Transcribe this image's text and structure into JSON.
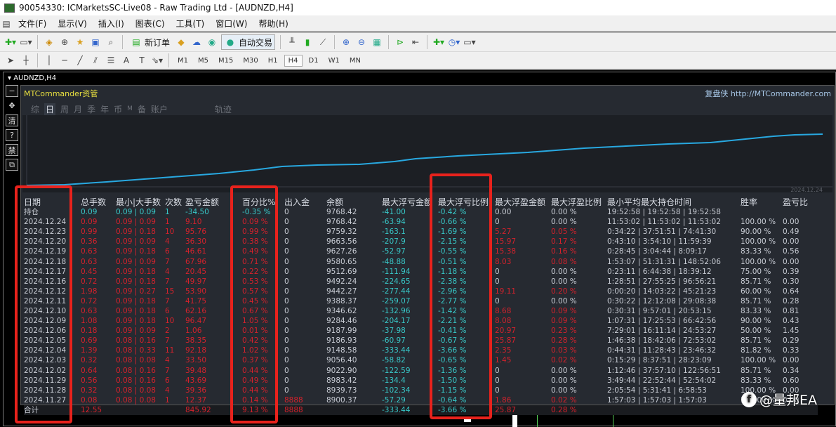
{
  "window": {
    "title": "90054330: ICMarketsSC-Live08 - Raw Trading Ltd - [AUDNZD,H4]"
  },
  "menu": [
    "文件(F)",
    "显示(V)",
    "插入(I)",
    "图表(C)",
    "工具(T)",
    "窗口(W)",
    "帮助(H)"
  ],
  "toolbar": {
    "new_order": "新订单",
    "auto_trading": "自动交易"
  },
  "timeframes": [
    "M1",
    "M5",
    "M15",
    "M30",
    "H1",
    "H4",
    "D1",
    "W1",
    "MN"
  ],
  "active_timeframe": "H4",
  "chart": {
    "header": "AUDNZD,H4"
  },
  "panel": {
    "title": "MTCommander资管",
    "link": "复盘侠 http://MTCommander.com",
    "tabs": [
      "综",
      "日",
      "周",
      "月",
      "季",
      "年",
      "币",
      "M",
      "备",
      "账户",
      "轨迹"
    ],
    "active_tab": "日",
    "equity_end_date": "2024.12.24"
  },
  "table": {
    "headers": [
      "日期",
      "总手数",
      "最小|大手数",
      "次数",
      "盈亏金额",
      "百分比%",
      "出入金",
      "余额",
      "最大浮亏金额",
      "最大浮亏比例",
      "最大浮盈金额",
      "最大浮盈比例",
      "最小平均最大持仓时间",
      "胜率",
      "盈亏比"
    ],
    "rows": [
      [
        "持仓",
        "0.09",
        "0.09 | 0.09",
        "1",
        "-34.50",
        "-0.35 %",
        "0",
        "9768.42",
        "-41.00",
        "-0.42 %",
        "0.00",
        "0.00 %",
        "19:52:58 | 19:52:58 | 19:52:58",
        "",
        ""
      ],
      [
        "2024.12.24",
        "0.09",
        "0.09 | 0.09",
        "1",
        "9.10",
        "0.09 %",
        "0",
        "9768.42",
        "-63.94",
        "-0.66 %",
        "0",
        "0.00 %",
        "11:53:02 | 11:53:02 | 11:53:02",
        "100.00 %",
        "0.00"
      ],
      [
        "2024.12.23",
        "0.99",
        "0.09 | 0.18",
        "10",
        "95.76",
        "0.99 %",
        "0",
        "9759.32",
        "-163.1",
        "-1.69 %",
        "5.27",
        "0.05 %",
        "0:34:22 | 37:51:51 | 74:41:30",
        "90.00 %",
        "0.49"
      ],
      [
        "2024.12.20",
        "0.36",
        "0.09 | 0.09",
        "4",
        "36.30",
        "0.38 %",
        "0",
        "9663.56",
        "-207.9",
        "-2.15 %",
        "15.97",
        "0.17 %",
        "0:43:10 | 3:54:10 | 11:59:39",
        "100.00 %",
        "0.00"
      ],
      [
        "2024.12.19",
        "0.63",
        "0.09 | 0.18",
        "6",
        "46.61",
        "0.49 %",
        "0",
        "9627.26",
        "-52.97",
        "-0.55 %",
        "15.38",
        "0.16 %",
        "0:28:45 | 3:04:44 | 8:09:17",
        "83.33 %",
        "0.56"
      ],
      [
        "2024.12.18",
        "0.63",
        "0.09 | 0.09",
        "7",
        "67.96",
        "0.71 %",
        "0",
        "9580.65",
        "-48.88",
        "-0.51 %",
        "8.03",
        "0.08 %",
        "1:53:07 | 51:31:31 | 148:52:06",
        "100.00 %",
        "0.00"
      ],
      [
        "2024.12.17",
        "0.45",
        "0.09 | 0.18",
        "4",
        "20.45",
        "0.22 %",
        "0",
        "9512.69",
        "-111.94",
        "-1.18 %",
        "0",
        "0.00 %",
        "0:23:11 | 6:44:38 | 18:39:12",
        "75.00 %",
        "0.39"
      ],
      [
        "2024.12.16",
        "0.72",
        "0.09 | 0.18",
        "7",
        "49.97",
        "0.53 %",
        "0",
        "9492.24",
        "-224.65",
        "-2.38 %",
        "0",
        "0.00 %",
        "1:28:51 | 27:55:25 | 96:56:21",
        "85.71 %",
        "0.30"
      ],
      [
        "2024.12.12",
        "1.98",
        "0.09 | 0.27",
        "15",
        "53.90",
        "0.57 %",
        "0",
        "9442.27",
        "-277.44",
        "-2.96 %",
        "19.11",
        "0.20 %",
        "0:00:20 | 14:03:22 | 45:21:23",
        "60.00 %",
        "0.64"
      ],
      [
        "2024.12.11",
        "0.72",
        "0.09 | 0.18",
        "7",
        "41.75",
        "0.45 %",
        "0",
        "9388.37",
        "-259.07",
        "-2.77 %",
        "0",
        "0.00 %",
        "0:30:22 | 12:12:08 | 29:08:38",
        "85.71 %",
        "0.28"
      ],
      [
        "2024.12.10",
        "0.63",
        "0.09 | 0.18",
        "6",
        "62.16",
        "0.67 %",
        "0",
        "9346.62",
        "-132.96",
        "-1.42 %",
        "8.68",
        "0.09 %",
        "0:30:31 | 9:57:01 | 20:53:15",
        "83.33 %",
        "0.81"
      ],
      [
        "2024.12.09",
        "1.08",
        "0.09 | 0.18",
        "10",
        "96.47",
        "1.05 %",
        "0",
        "9284.46",
        "-204.17",
        "-2.21 %",
        "8.08",
        "0.09 %",
        "1:07:31 | 17:25:53 | 66:42:56",
        "90.00 %",
        "0.43"
      ],
      [
        "2024.12.06",
        "0.18",
        "0.09 | 0.09",
        "2",
        "1.06",
        "0.01 %",
        "0",
        "9187.99",
        "-37.98",
        "-0.41 %",
        "20.97",
        "0.23 %",
        "7:29:01 | 16:11:14 | 24:53:27",
        "50.00 %",
        "1.45"
      ],
      [
        "2024.12.05",
        "0.69",
        "0.08 | 0.16",
        "7",
        "38.35",
        "0.42 %",
        "0",
        "9186.93",
        "-60.97",
        "-0.67 %",
        "25.87",
        "0.28 %",
        "1:46:38 | 18:42:06 | 72:53:02",
        "85.71 %",
        "0.29"
      ],
      [
        "2024.12.04",
        "1.39",
        "0.08 | 0.33",
        "11",
        "92.18",
        "1.02 %",
        "0",
        "9148.58",
        "-333.44",
        "-3.66 %",
        "2.35",
        "0.03 %",
        "0:44:31 | 11:28:43 | 23:46:32",
        "81.82 %",
        "0.33"
      ],
      [
        "2024.12.03",
        "0.32",
        "0.08 | 0.08",
        "4",
        "33.50",
        "0.37 %",
        "0",
        "9056.40",
        "-58.82",
        "-0.65 %",
        "1.45",
        "0.02 %",
        "0:15:29 | 8:37:51 | 28:23:09",
        "100.00 %",
        "0.00"
      ],
      [
        "2024.12.02",
        "0.64",
        "0.08 | 0.16",
        "7",
        "39.48",
        "0.44 %",
        "0",
        "9022.90",
        "-122.59",
        "-1.36 %",
        "0",
        "0.00 %",
        "1:12:46 | 37:57:10 | 122:56:51",
        "85.71 %",
        "0.34"
      ],
      [
        "2024.11.29",
        "0.56",
        "0.08 | 0.16",
        "6",
        "43.69",
        "0.49 %",
        "0",
        "8983.42",
        "-134.4",
        "-1.50 %",
        "0",
        "0.00 %",
        "3:49:44 | 22:52:44 | 52:54:02",
        "83.33 %",
        "0.60"
      ],
      [
        "2024.11.28",
        "0.32",
        "0.08 | 0.08",
        "4",
        "39.36",
        "0.44 %",
        "0",
        "8939.73",
        "-102.34",
        "-1.15 %",
        "0",
        "0.00 %",
        "2:05:54 | 5:31:41 | 6:58:53",
        "100.00 %",
        "0.00"
      ],
      [
        "2024.11.27",
        "0.08",
        "0.08 | 0.08",
        "1",
        "12.37",
        "0.14 %",
        "8888",
        "8900.37",
        "-57.29",
        "-0.64 %",
        "1.86",
        "0.02 %",
        "1:57:03 | 1:57:03 | 1:57:03",
        "100.00 %",
        "0.00"
      ],
      [
        "合计",
        "12.55",
        "",
        "",
        "845.92",
        "9.13 %",
        "8888",
        "",
        "-333.44",
        "-3.66 %",
        "25.87",
        "0.28 %",
        "",
        "",
        ""
      ]
    ]
  },
  "watermark": "@量邦EA",
  "colors": {
    "panel_bg": "#262a31",
    "profit_red": "#d4222c",
    "loss_cyan": "#38c8c8",
    "equity_line": "#28a8e0",
    "highlight_box": "#e8221c"
  }
}
